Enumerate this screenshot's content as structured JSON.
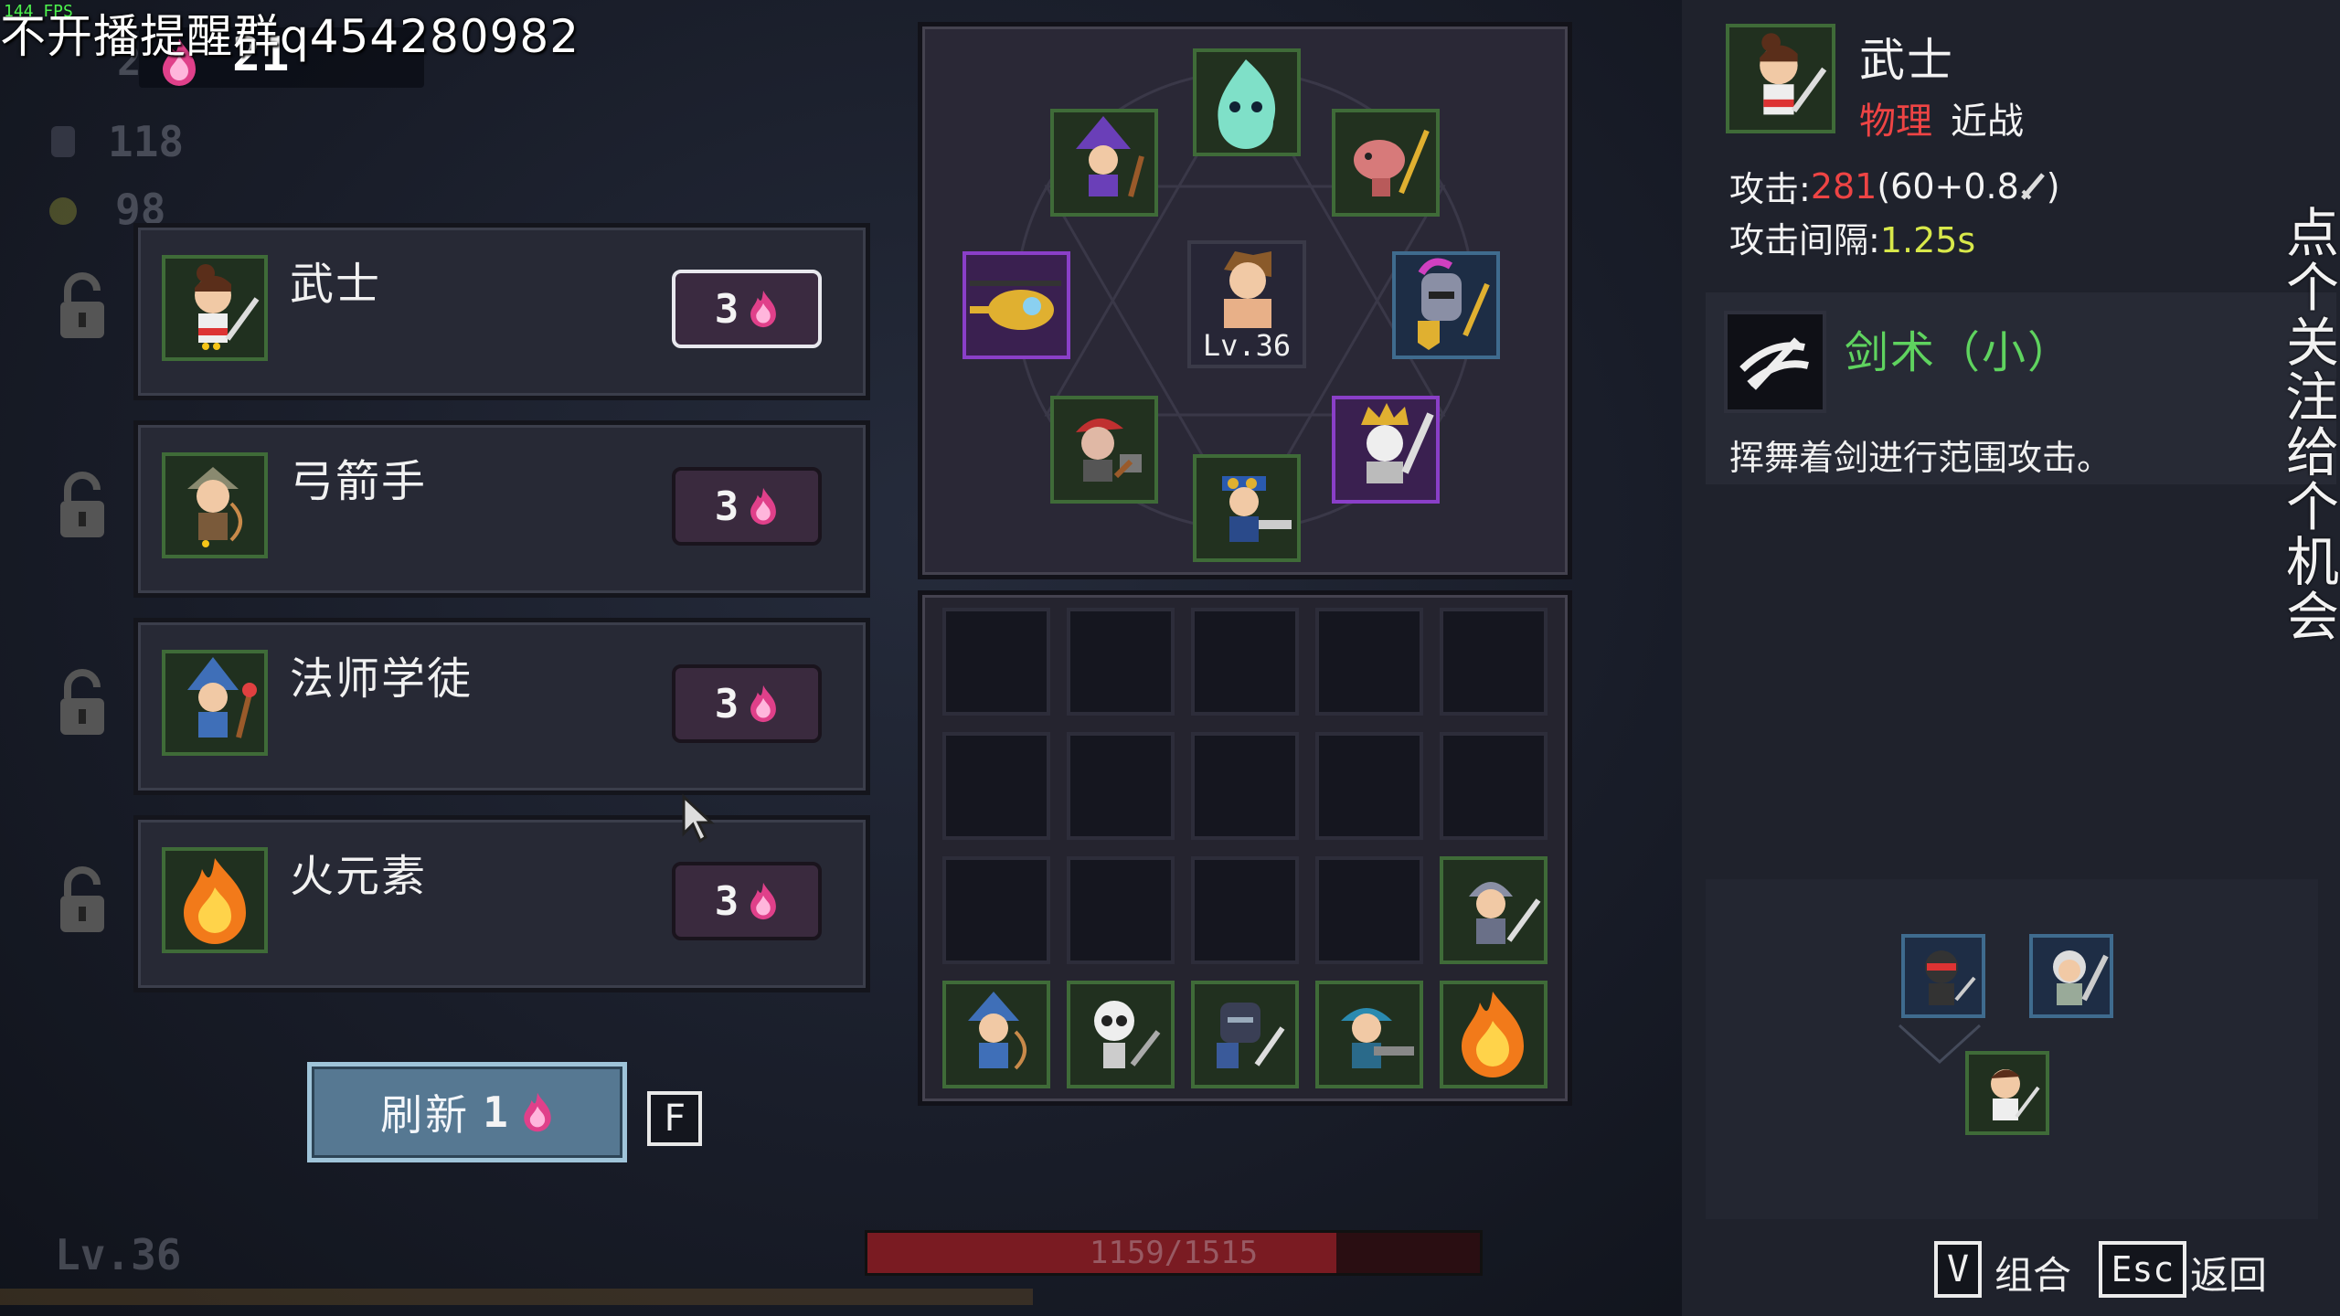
{
  "overlay": {
    "stream_text": "不开播提醒群q454280982",
    "vertical_text": "点个关注，给个机会",
    "fps": "144 FPS"
  },
  "resources": {
    "fire": "21",
    "fire_faded": "2",
    "crystals": "118",
    "coins": "98",
    "player_level": "Lv.36"
  },
  "shop": {
    "cards": [
      {
        "name": "武士",
        "cost": "3",
        "portrait": "samurai-icon",
        "selected": true
      },
      {
        "name": "弓箭手",
        "cost": "3",
        "portrait": "archer-icon",
        "selected": false
      },
      {
        "name": "法师学徒",
        "cost": "3",
        "portrait": "mage-apprentice-icon",
        "selected": false
      },
      {
        "name": "火元素",
        "cost": "3",
        "portrait": "fire-elemental-icon",
        "selected": false
      }
    ],
    "refresh_label": "刷新",
    "refresh_cost": "1",
    "refresh_key": "F"
  },
  "formation": {
    "hero_level": "Lv.36"
  },
  "hp": {
    "text": "1159/1515",
    "current": 1159,
    "max": 1515
  },
  "info": {
    "name": "武士",
    "damage_type": "物理",
    "range_type": "近战",
    "attack_label": "攻击:",
    "attack_value": "281",
    "attack_formula": "(60+0.8",
    "attack_formula_end": ")",
    "interval_label": "攻击间隔:",
    "interval_value": "1.25s",
    "skill_name": "剑术（小）",
    "skill_desc": "挥舞着剑进行范围攻击。"
  },
  "footer": {
    "combo_key": "V",
    "combo_label": "组合",
    "back_key": "Esc",
    "back_label": "返回"
  },
  "colors": {
    "fire": "#e0408a",
    "physical": "#ee4444",
    "skill": "#5fd35f",
    "interval": "#d8e84a"
  }
}
